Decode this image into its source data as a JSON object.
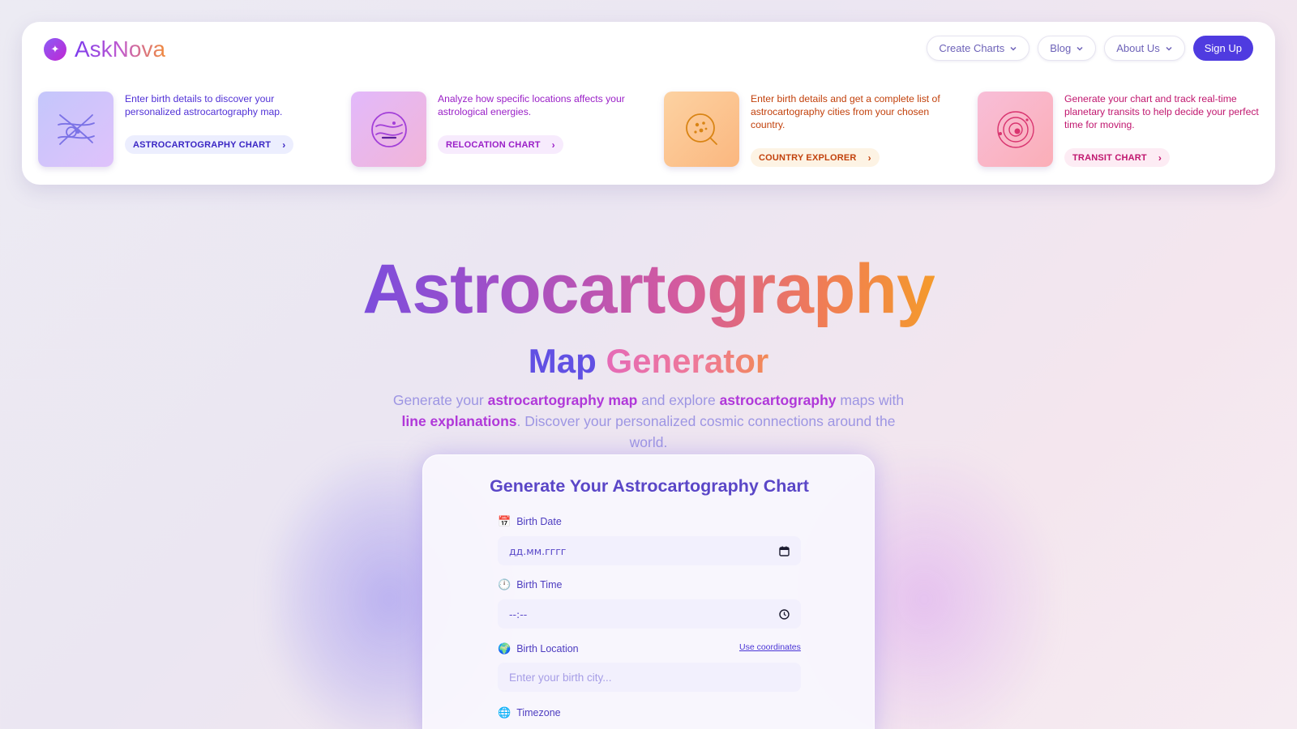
{
  "brand": {
    "name": "AskNova",
    "logo_icon": "sparkle-icon"
  },
  "nav": {
    "create_charts": "Create Charts",
    "blog": "Blog",
    "about_us": "About Us",
    "sign_up": "Sign Up"
  },
  "features": [
    {
      "description": "Enter birth details to discover your personalized astrocartography map.",
      "cta": "ASTROCARTOGRAPHY CHART",
      "icon": "crossing-lines-icon"
    },
    {
      "description": "Analyze how specific locations affects your astrological energies.",
      "cta": "RELOCATION CHART",
      "icon": "globe-waves-icon"
    },
    {
      "description": "Enter birth details and get a complete list of astrocartography cities from your chosen country.",
      "cta": "COUNTRY EXPLORER",
      "icon": "globe-search-icon"
    },
    {
      "description": "Generate your chart and track real-time planetary transits to help decide your perfect time for moving.",
      "cta": "TRANSIT CHART",
      "icon": "orbit-icon"
    }
  ],
  "hero": {
    "title": "Astrocartography",
    "subtitle_word1": "Map",
    "subtitle_word2": "Generator",
    "desc_parts": {
      "p1": "Generate your ",
      "b1": "astrocartography map",
      "p2": " and explore ",
      "b2": "astrocartography",
      "p3": " maps with ",
      "b3": "line explanations",
      "p4": ". Discover your personalized cosmic connections around the world."
    }
  },
  "form": {
    "title": "Generate Your Astrocartography Chart",
    "birth_date_label": "Birth Date",
    "birth_date_value": "дд.мм.гггг",
    "birth_time_label": "Birth Time",
    "birth_time_value": "--:--",
    "birth_location_label": "Birth Location",
    "use_coordinates": "Use coordinates",
    "birth_location_placeholder": "Enter your birth city...",
    "timezone_label": "Timezone"
  },
  "colors": {
    "primary": "#4f3be0",
    "accent_pink": "#e56ab7",
    "accent_orange": "#f49a2c"
  }
}
